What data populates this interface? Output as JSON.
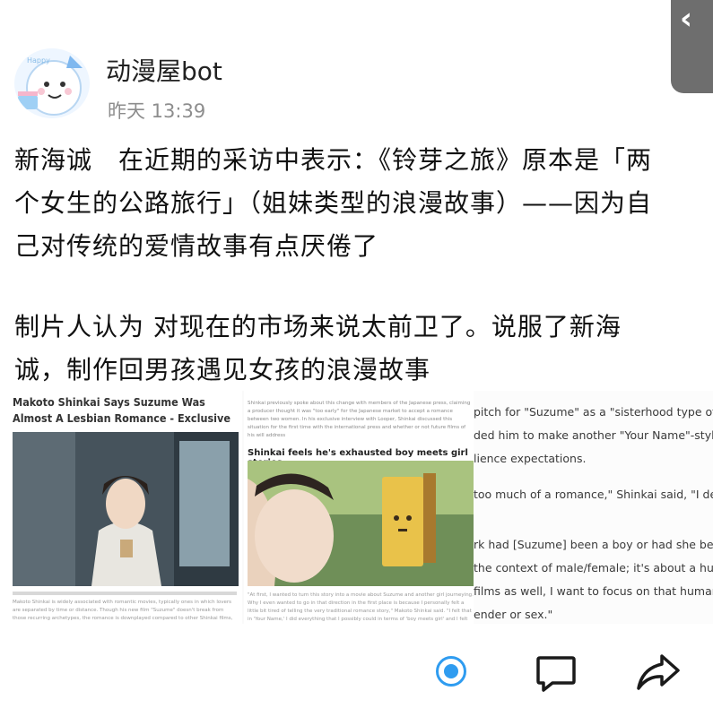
{
  "header": {
    "username": "动漫屋bot",
    "timestamp": "昨天 13:39"
  },
  "post": {
    "lines": [
      "新海诚　在近期的采访中表示：《铃芽之旅》原本是「两",
      "个女生的公路旅行」（姐妹类型的浪漫故事）——因为自",
      "己对传统的爱情故事有点厌倦了",
      "制片人认为 对现在的市场来说太前卫了。说服了新海",
      "诚，制作回男孩遇见女孩的浪漫故事"
    ]
  },
  "article": {
    "headline": "Makoto Shinkai Says Suzume Was Almost A Lesbian Romance - Exclusive",
    "panel1_body": "Makoto Shinkai is widely associated with romantic movies, typically ones in which lovers are separated by time or distance. Though his new film \"Suzume\" doesn't break from those recurring archetypes, the romance is downplayed compared to other Shinkai films, in no small part thanks to the male lead, Souta, turning into a chair for most of the movie's runtime.",
    "panel2_top": "Shinkai previously spoke about this change with members of the Japanese press, claiming a producer thought it was \"too early\" for the Japanese market to accept a romance between two women. In his exclusive interview with Looper, Shinkai discussed this situation for the first time with the international press and whether or not future films of his will address",
    "panel2_subheading": "Shinkai feels he's exhausted boy meets girl stories",
    "panel2_bottom": "\"At first, I wanted to turn this story into a movie about Suzume and another girl journeying. Why I even wanted to go in that direction in the first place is because I personally felt a little bit tired of telling the very traditional romance story,\" Makoto Shinkai said. \"I felt that in 'Your Name,' I did everything that I possibly could in terms of 'boy meets girl' and I felt there",
    "panel3_lines": [
      "pitch for \"Suzume\" as a \"sisterhood type of",
      "ded him to make another \"Your Name\"-styl",
      "lience expectations.",
      "too much of a romance,\" Shinkai said, \"I deci",
      "rk had [Suzume] been a boy or had she beer",
      "the context of male/female; it's about a hu",
      "films as well, I want to focus on that human",
      "ender or sex.\""
    ]
  },
  "actions": {
    "radio_icon": "radio-dot-icon",
    "comment_icon": "comment-icon",
    "share_icon": "share-arrow-icon"
  },
  "colors": {
    "accent": "#2f9cf0",
    "text": "#111111",
    "muted": "#8d8d8d"
  }
}
